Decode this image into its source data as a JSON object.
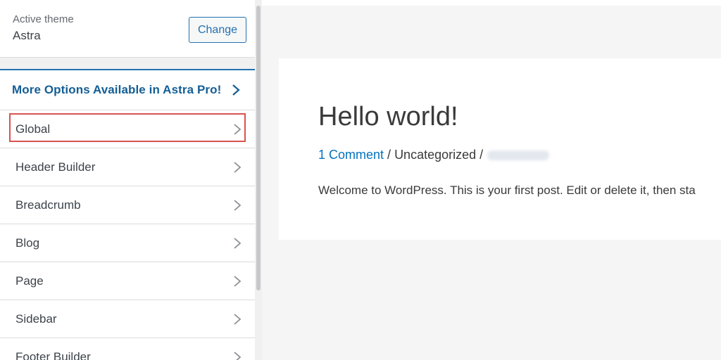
{
  "theme": {
    "label": "Active theme",
    "name": "Astra",
    "change_label": "Change"
  },
  "panels": {
    "pro_link": "More Options Available in Astra Pro!",
    "items": [
      {
        "label": "Global"
      },
      {
        "label": "Header Builder"
      },
      {
        "label": "Breadcrumb"
      },
      {
        "label": "Blog"
      },
      {
        "label": "Page"
      },
      {
        "label": "Sidebar"
      },
      {
        "label": "Footer Builder"
      }
    ]
  },
  "preview": {
    "post_title": "Hello world!",
    "comments_link": "1 Comment",
    "sep1": " / ",
    "category": "Uncategorized",
    "sep2": " /",
    "excerpt": "Welcome to WordPress. This is your first post. Edit or delete it, then sta"
  },
  "colors": {
    "accent": "#2271b1",
    "link": "#135e96",
    "highlight": "#d9534f"
  }
}
